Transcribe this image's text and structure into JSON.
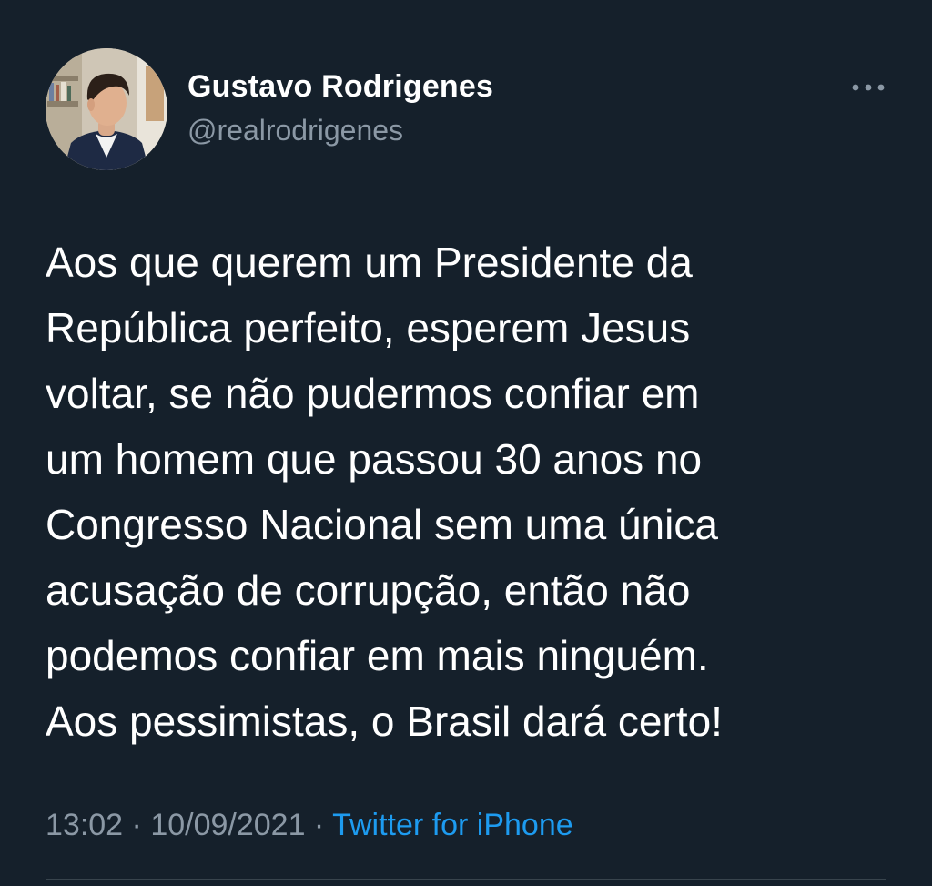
{
  "author": {
    "display_name": "Gustavo Rodrigenes",
    "handle": "@realrodrigenes"
  },
  "more_icon": "more-horizontal-icon",
  "tweet": {
    "text": "Aos que querem um Presidente da\nRepública perfeito, esperem Jesus\nvoltar, se não pudermos confiar em\num homem que passou 30 anos no\nCongresso Nacional sem uma única\nacusação de corrupção, então não\npodemos confiar em mais ninguém.\nAos pessimistas, o Brasil dará certo!"
  },
  "meta": {
    "time": "13:02",
    "separator": " · ",
    "date": "10/09/2021",
    "source": "Twitter for iPhone"
  },
  "colors": {
    "background": "#15202b",
    "secondary_text": "#8b98a5",
    "link": "#1d9bf0"
  }
}
